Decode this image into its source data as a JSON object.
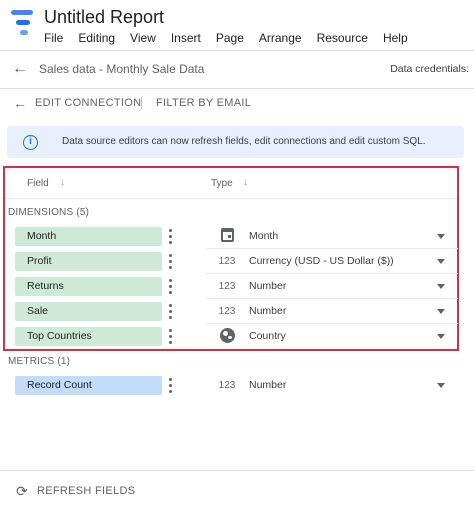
{
  "app": {
    "title": "Untitled Report",
    "menu": [
      "File",
      "Editing",
      "View",
      "Insert",
      "Page",
      "Arrange",
      "Resource",
      "Help"
    ]
  },
  "data_source": {
    "title": "Sales data  - Monthly Sale Data",
    "credentials_label": "Data credentials:"
  },
  "actions": {
    "edit_connection": "EDIT CONNECTION",
    "filter_by_email": "FILTER BY EMAIL"
  },
  "banner": {
    "icon": "info-icon",
    "text": "Data source editors can now refresh fields, edit connections and edit custom SQL."
  },
  "columns": {
    "field": "Field",
    "type": "Type"
  },
  "dimensions": {
    "label": "DIMENSIONS (5)",
    "items": [
      {
        "name": "Month",
        "type_icon": "calendar-icon",
        "type": "Month"
      },
      {
        "name": "Profit",
        "type_icon": "123",
        "type": "Currency (USD - US Dollar ($))"
      },
      {
        "name": "Returns",
        "type_icon": "123",
        "type": "Number"
      },
      {
        "name": "Sale",
        "type_icon": "123",
        "type": "Number"
      },
      {
        "name": "Top Countries",
        "type_icon": "globe-icon",
        "type": "Country"
      }
    ]
  },
  "metrics": {
    "label": "METRICS (1)",
    "items": [
      {
        "name": "Record Count",
        "type_icon": "123",
        "type": "Number"
      }
    ]
  },
  "footer": {
    "refresh_label": "REFRESH FIELDS"
  },
  "colors": {
    "dimension_chip": "#ceead6",
    "metric_chip": "#c2dcfa",
    "highlight_border": "#d32f45",
    "banner_bg": "#e8f0fe",
    "accent": "#1a73e8"
  }
}
